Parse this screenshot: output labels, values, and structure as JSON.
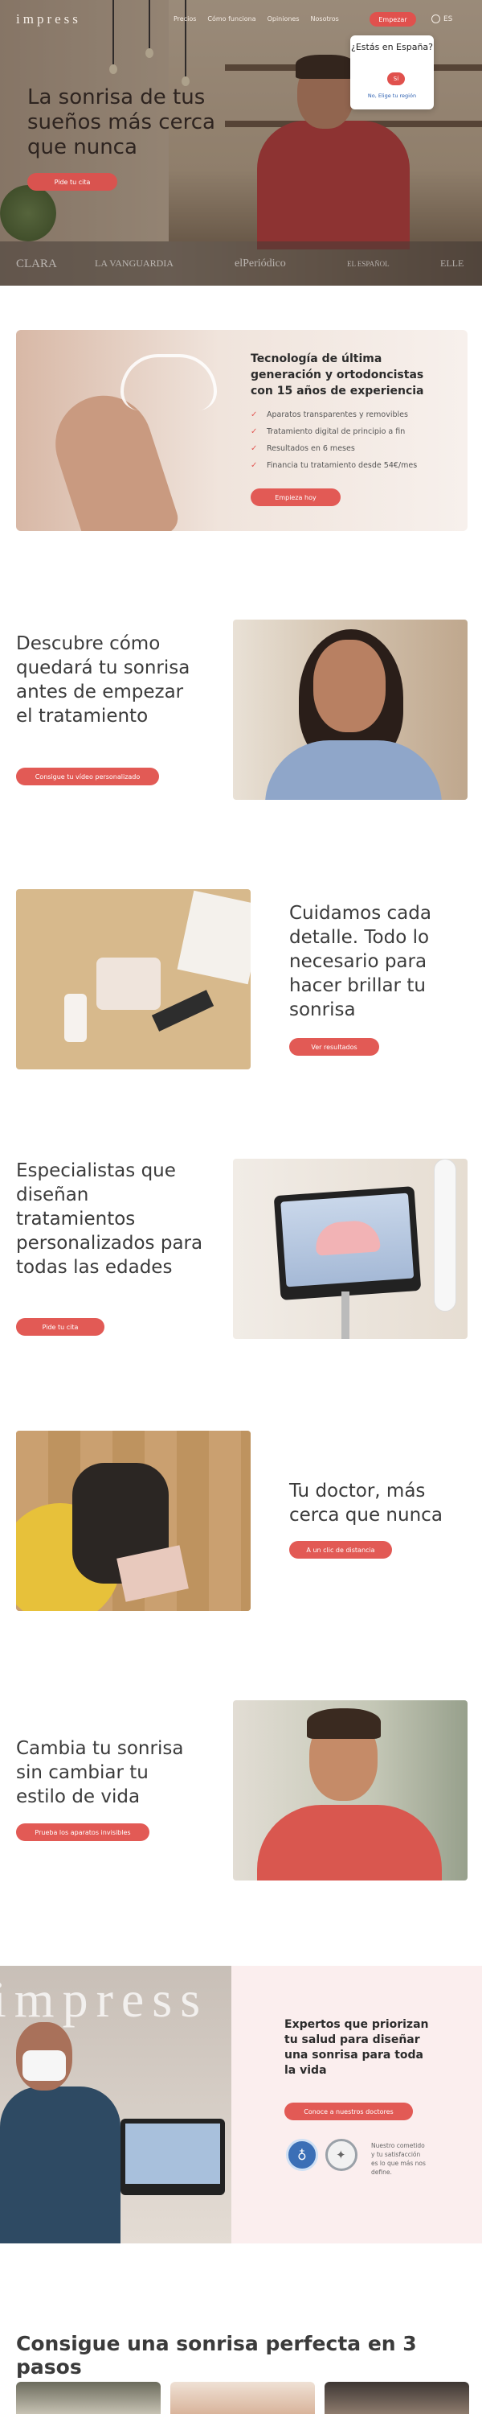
{
  "nav": {
    "logo": "impress",
    "links": [
      "Precios",
      "Cómo funciona",
      "Opiniones",
      "Nosotros"
    ],
    "cta": "Empezar",
    "lang": "ES"
  },
  "lang_popup": {
    "question": "¿Estás en España?",
    "yes": "Sí",
    "other": "No, Elige tu región"
  },
  "hero": {
    "title": "La sonrisa de tus sueños más cerca que nunca",
    "cta": "Pide tu cita",
    "press": [
      "CLARA",
      "LA VANGUARDIA",
      "elPeriódico",
      "EL ESPAÑOL",
      "ELLE"
    ]
  },
  "tech": {
    "title": "Tecnología de última generación y ortodoncistas con 15 años de experiencia",
    "bullets": [
      "Aparatos transparentes y removibles",
      "Tratamiento digital de principio a fin",
      "Resultados en 6 meses",
      "Financia tu tratamiento desde 54€/mes"
    ],
    "cta": "Empieza hoy"
  },
  "sections": {
    "video": {
      "title": "Descubre cómo quedará tu sonrisa antes de empezar el tratamiento",
      "cta": "Consigue tu vídeo personalizado"
    },
    "details": {
      "title": "Cuidamos cada detalle. Todo lo necesario para hacer brillar tu sonrisa",
      "cta": "Ver resultados"
    },
    "specialists": {
      "title": "Especialistas que diseñan tratamientos personalizados para todas las edades",
      "cta": "Pide tu cita"
    },
    "doctor": {
      "title": "Tu doctor, más cerca que nunca",
      "cta": "A un clic de distancia"
    },
    "lifestyle": {
      "title": "Cambia tu sonrisa sin cambiar tu estilo de vida",
      "cta": "Prueba los aparatos invisibles"
    }
  },
  "experts": {
    "wordmark": "impress",
    "title": "Expertos que priorizan tu salud para diseñar una sonrisa para toda la vida",
    "cta": "Conoce a nuestros doctores",
    "note": "Nuestro cometido y tu satisfacción es lo que más nos define."
  },
  "steps": {
    "title": "Consigue una sonrisa perfecta en 3 pasos"
  },
  "icons": {
    "check": "check-icon",
    "globe": "globe-icon",
    "tooth": "tooth-icon",
    "seal": "seal-icon"
  },
  "colors": {
    "accent": "#e25a55",
    "experts_bg": "#fbeeee"
  }
}
